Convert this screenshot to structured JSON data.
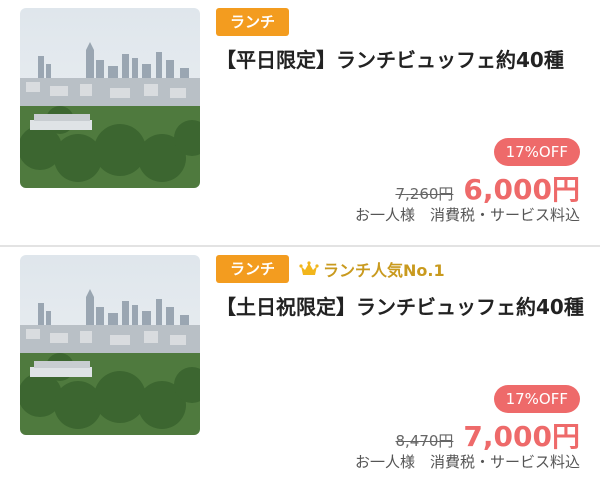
{
  "colors": {
    "tag_bg": "#f39c1f",
    "rank_text": "#c99a1e",
    "price_accent": "#ee6a6a"
  },
  "plans": [
    {
      "tag": "ランチ",
      "title": "【平日限定】ランチビュッフェ約40種",
      "discount": "17%OFF",
      "original_price": "7,260円",
      "price": "6,000円",
      "note": "お一人様　消費税・サービス料込"
    },
    {
      "tag": "ランチ",
      "rank_icon": "crown-icon",
      "rank": "ランチ人気No.1",
      "title": "【土日祝限定】ランチビュッフェ約40種",
      "discount": "17%OFF",
      "original_price": "8,470円",
      "price": "7,000円",
      "note": "お一人様　消費税・サービス料込"
    }
  ]
}
